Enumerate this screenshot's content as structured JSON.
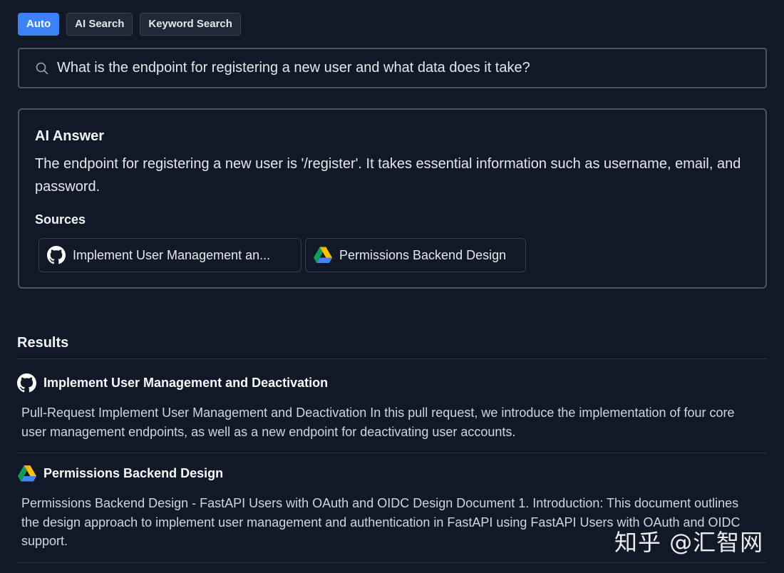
{
  "tabs": [
    {
      "label": "Auto",
      "active": true
    },
    {
      "label": "AI Search",
      "active": false
    },
    {
      "label": "Keyword Search",
      "active": false
    }
  ],
  "search": {
    "value": "What is the endpoint for registering a new user and what data does it take?",
    "icon": "search-icon"
  },
  "answer": {
    "title": "AI Answer",
    "text": "The endpoint for registering a new user is '/register'. It takes essential information such as username, email, and password.",
    "sources_title": "Sources",
    "sources": [
      {
        "label": "Implement User Management an...",
        "icon": "github-icon"
      },
      {
        "label": "Permissions Backend Design",
        "icon": "google-drive-icon"
      }
    ]
  },
  "results": {
    "title": "Results",
    "items": [
      {
        "title": "Implement User Management and Deactivation",
        "icon": "github-icon",
        "body": "Pull-Request Implement User Management and Deactivation In this pull request, we introduce the implementation of four core user management endpoints, as well as a new endpoint for deactivating user accounts."
      },
      {
        "title": "Permissions Backend Design",
        "icon": "google-drive-icon",
        "body": "Permissions Backend Design - FastAPI Users with OAuth and OIDC Design Document 1. Introduction: This document outlines the design approach to implement user management and authentication in FastAPI using FastAPI Users with OAuth and OIDC support."
      }
    ]
  },
  "watermark": "知乎 @汇智网",
  "colors": {
    "background": "#111827",
    "accent": "#3b82f6",
    "border": "#4b5563"
  }
}
